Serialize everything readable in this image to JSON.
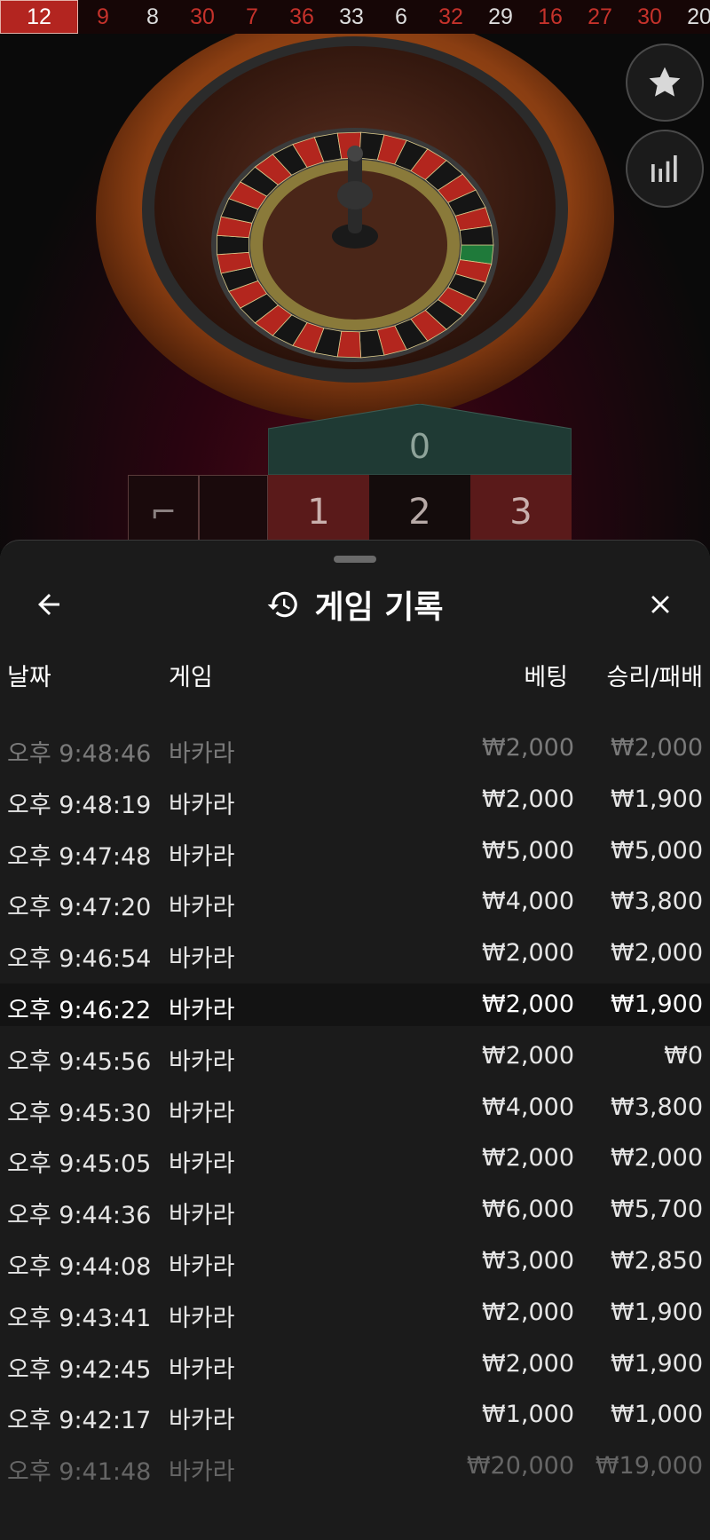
{
  "results_strip": [
    {
      "n": "12",
      "color": "red"
    },
    {
      "n": "9",
      "color": "red"
    },
    {
      "n": "8",
      "color": "black"
    },
    {
      "n": "30",
      "color": "red"
    },
    {
      "n": "7",
      "color": "red"
    },
    {
      "n": "36",
      "color": "red"
    },
    {
      "n": "33",
      "color": "black"
    },
    {
      "n": "6",
      "color": "black"
    },
    {
      "n": "32",
      "color": "red"
    },
    {
      "n": "29",
      "color": "black"
    },
    {
      "n": "16",
      "color": "red"
    },
    {
      "n": "27",
      "color": "red"
    },
    {
      "n": "30",
      "color": "red"
    },
    {
      "n": "20",
      "color": "black"
    }
  ],
  "side_buttons": {
    "favorite_icon": "star-icon",
    "stats_icon": "bar-chart-icon"
  },
  "betting_table": {
    "zero": "0",
    "row": [
      "1",
      "2",
      "3"
    ]
  },
  "sheet": {
    "title": "게임 기록",
    "title_icon": "history-icon",
    "back_icon": "back-arrow-icon",
    "close_icon": "close-icon",
    "columns": {
      "date": "날짜",
      "game": "게임",
      "bet": "베팅",
      "win_loss": "승리/패배"
    },
    "rows": [
      {
        "time": "오후 9:48:46",
        "game": "바카라",
        "bet": "₩2,000",
        "result": "₩2,000"
      },
      {
        "time": "오후 9:48:19",
        "game": "바카라",
        "bet": "₩2,000",
        "result": "₩1,900"
      },
      {
        "time": "오후 9:47:48",
        "game": "바카라",
        "bet": "₩5,000",
        "result": "₩5,000"
      },
      {
        "time": "오후 9:47:20",
        "game": "바카라",
        "bet": "₩4,000",
        "result": "₩3,800"
      },
      {
        "time": "오후 9:46:54",
        "game": "바카라",
        "bet": "₩2,000",
        "result": "₩2,000"
      },
      {
        "time": "오후 9:46:22",
        "game": "바카라",
        "bet": "₩2,000",
        "result": "₩1,900"
      },
      {
        "time": "오후 9:45:56",
        "game": "바카라",
        "bet": "₩2,000",
        "result": "₩0"
      },
      {
        "time": "오후 9:45:30",
        "game": "바카라",
        "bet": "₩4,000",
        "result": "₩3,800"
      },
      {
        "time": "오후 9:45:05",
        "game": "바카라",
        "bet": "₩2,000",
        "result": "₩2,000"
      },
      {
        "time": "오후 9:44:36",
        "game": "바카라",
        "bet": "₩6,000",
        "result": "₩5,700"
      },
      {
        "time": "오후 9:44:08",
        "game": "바카라",
        "bet": "₩3,000",
        "result": "₩2,850"
      },
      {
        "time": "오후 9:43:41",
        "game": "바카라",
        "bet": "₩2,000",
        "result": "₩1,900"
      },
      {
        "time": "오후 9:42:45",
        "game": "바카라",
        "bet": "₩2,000",
        "result": "₩1,900"
      },
      {
        "time": "오후 9:42:17",
        "game": "바카라",
        "bet": "₩1,000",
        "result": "₩1,000"
      },
      {
        "time": "오후 9:41:48",
        "game": "바카라",
        "bet": "₩20,000",
        "result": "₩19,000"
      }
    ]
  },
  "colors": {
    "red": "#c5322b",
    "black": "#dcdcdc",
    "sheet_bg": "#1b1b1b",
    "table_green": "#1f3a34"
  }
}
